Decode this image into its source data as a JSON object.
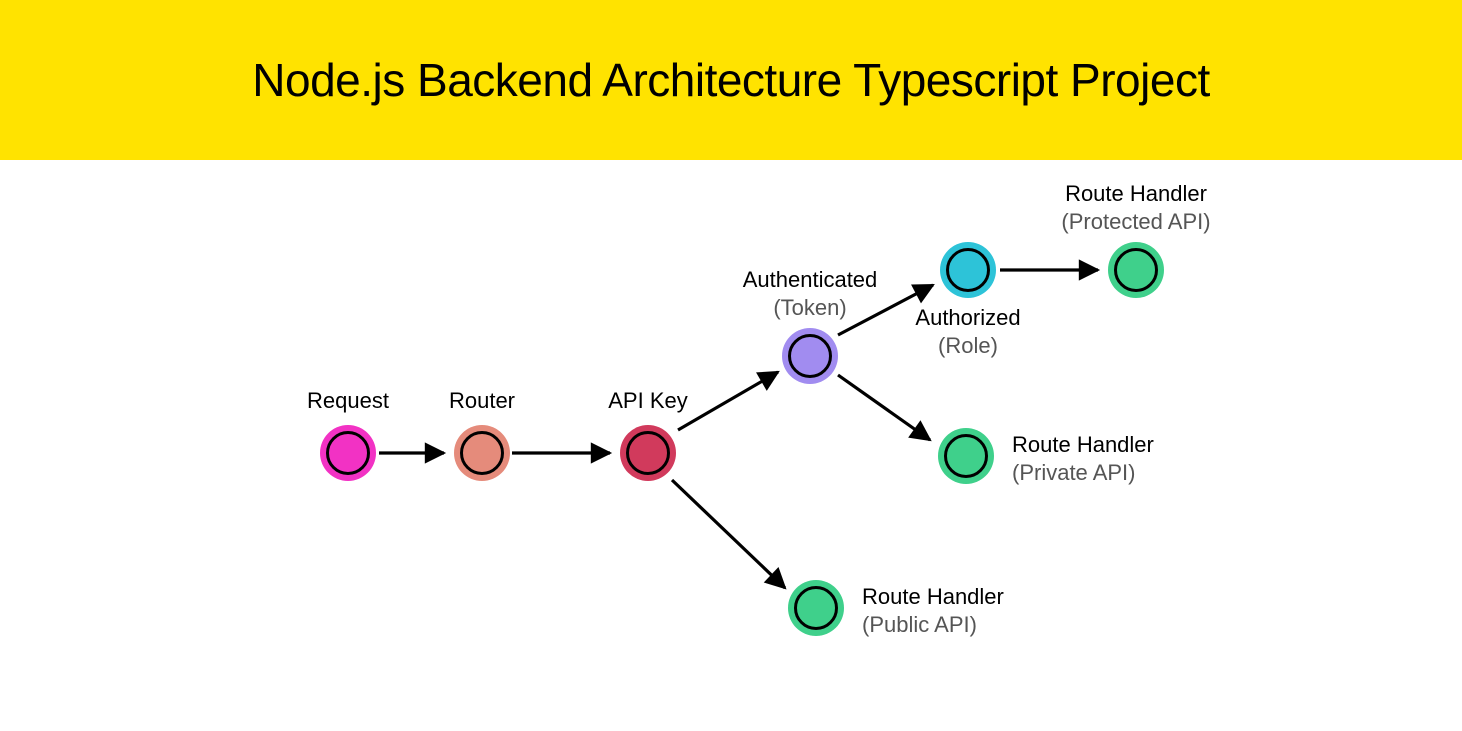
{
  "title": "Node.js Backend Architecture Typescript Project",
  "nodes": {
    "request": {
      "main": "Request",
      "sub": "",
      "color": "#f232c4"
    },
    "router": {
      "main": "Router",
      "sub": "",
      "color": "#e58b7b"
    },
    "apikey": {
      "main": "API Key",
      "sub": "",
      "color": "#d13a5c"
    },
    "authenticated": {
      "main": "Authenticated",
      "sub": "(Token)",
      "color": "#a18cf0"
    },
    "authorized": {
      "main": "Authorized",
      "sub": "(Role)",
      "color": "#2dc3d8"
    },
    "protected": {
      "main": "Route Handler",
      "sub": "(Protected API)",
      "color": "#3fd08b"
    },
    "private": {
      "main": "Route Handler",
      "sub": "(Private API)",
      "color": "#3fd08b"
    },
    "public": {
      "main": "Route Handler",
      "sub": "(Public API)",
      "color": "#3fd08b"
    }
  },
  "edges": [
    [
      "request",
      "router"
    ],
    [
      "router",
      "apikey"
    ],
    [
      "apikey",
      "authenticated"
    ],
    [
      "apikey",
      "public"
    ],
    [
      "authenticated",
      "authorized"
    ],
    [
      "authenticated",
      "private"
    ],
    [
      "authorized",
      "protected"
    ]
  ]
}
